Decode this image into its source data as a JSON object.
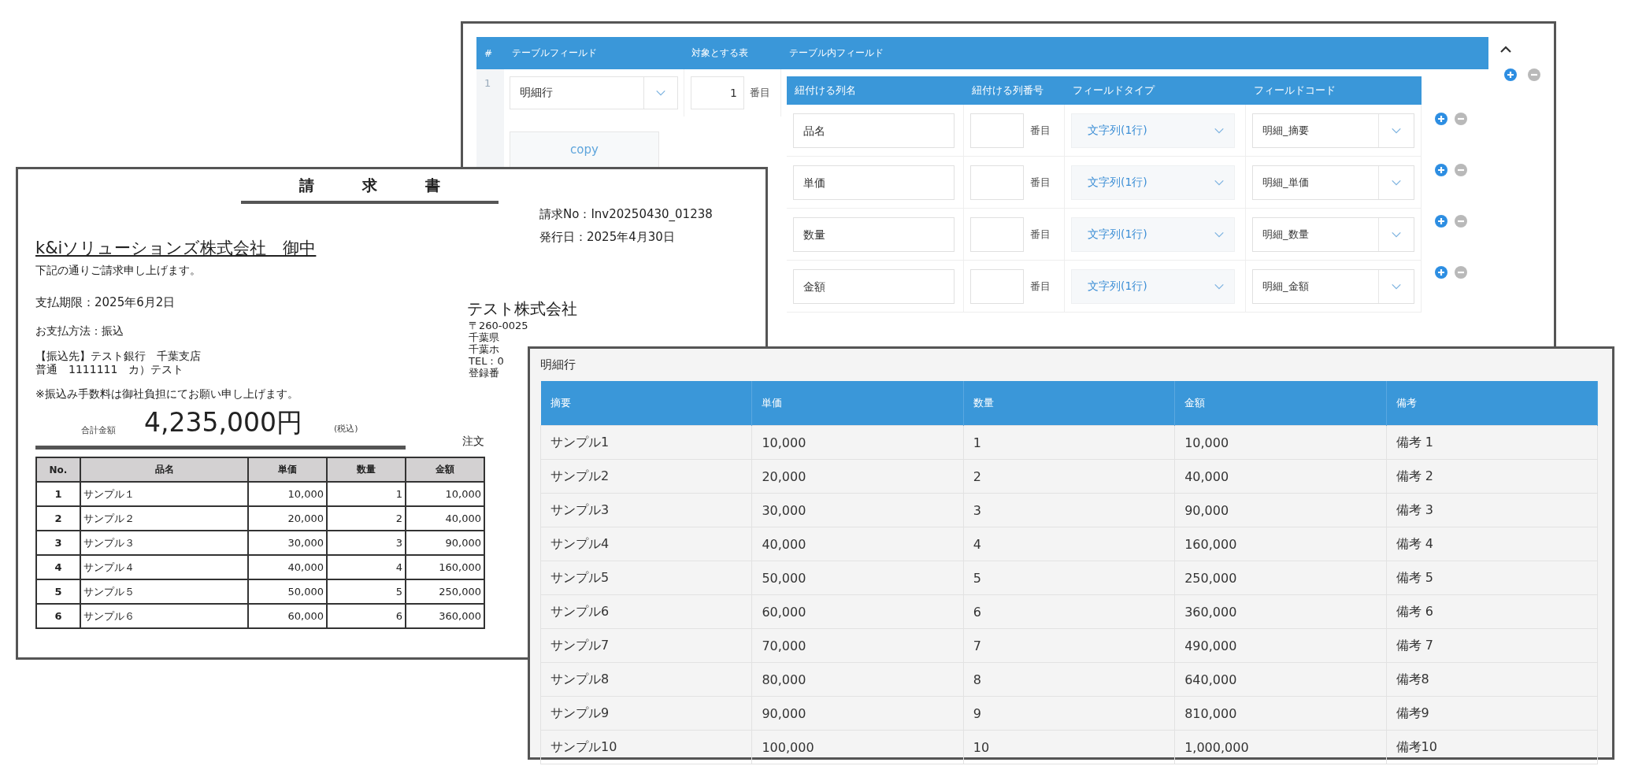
{
  "mapping_window": {
    "header": {
      "index": "#",
      "columns": [
        "テーブルフィールド",
        "対象とする表",
        "テーブル内フィールド"
      ]
    },
    "entry": {
      "index": "1",
      "table_field": "明細行",
      "copy_button": "copy",
      "table_number": "1",
      "number_suffix": "番目",
      "inner_columns": [
        "紐付ける列名",
        "紐付ける列番号",
        "フィールドタイプ",
        "フィールドコード"
      ],
      "rows": [
        {
          "column_name": "品名",
          "suffix": "番目",
          "field_type": "文字列(1行)",
          "field_code": "明細_摘要"
        },
        {
          "column_name": "単価",
          "suffix": "番目",
          "field_type": "文字列(1行)",
          "field_code": "明細_単価"
        },
        {
          "column_name": "数量",
          "suffix": "番目",
          "field_type": "文字列(1行)",
          "field_code": "明細_数量"
        },
        {
          "column_name": "金額",
          "suffix": "番目",
          "field_type": "文字列(1行)",
          "field_code": "明細_金額"
        }
      ]
    }
  },
  "invoice": {
    "title": "請求書",
    "invoice_number": "請求No：Inv20250430_01238",
    "issue_date": "発行日：2025年4月30日",
    "addressee": "k&iソリューションズ株式会社　御中",
    "greeting": "下記の通りご請求申し上げます。",
    "due_date": "支払期限：2025年6月2日",
    "payment_method": "お支払方法：振込",
    "bank": [
      "【振込先】テスト銀行　千葉支店",
      "普通　1111111　カ）テスト"
    ],
    "fee_note": "※振込み手数料は御社負担にてお願い申し上げます。",
    "total_label": "合計金額",
    "total_amount": "4,235,000円",
    "tax_note": "(税込)",
    "order_label": "注文",
    "sender": {
      "name": "テスト株式会社",
      "lines": [
        "〒260-0025",
        "千葉県",
        "千葉ホ",
        "TEL：0",
        "登録番"
      ]
    },
    "table": {
      "columns": [
        "No.",
        "品名",
        "単価",
        "数量",
        "金額"
      ],
      "rows": [
        [
          "1",
          "サンプル１",
          "10,000",
          "1",
          "10,000"
        ],
        [
          "2",
          "サンプル２",
          "20,000",
          "2",
          "40,000"
        ],
        [
          "3",
          "サンプル３",
          "30,000",
          "3",
          "90,000"
        ],
        [
          "4",
          "サンプル４",
          "40,000",
          "4",
          "160,000"
        ],
        [
          "5",
          "サンプル５",
          "50,000",
          "5",
          "250,000"
        ],
        [
          "6",
          "サンプル６",
          "60,000",
          "6",
          "360,000"
        ]
      ]
    }
  },
  "detail_window": {
    "title": "明細行",
    "columns": [
      "摘要",
      "単価",
      "数量",
      "金額",
      "備考"
    ],
    "rows": [
      [
        "サンプル1",
        "10,000",
        "1",
        "10,000",
        "備考 1"
      ],
      [
        "サンプル2",
        "20,000",
        "2",
        "40,000",
        "備考 2"
      ],
      [
        "サンプル3",
        "30,000",
        "3",
        "90,000",
        "備考 3"
      ],
      [
        "サンプル4",
        "40,000",
        "4",
        "160,000",
        "備考 4"
      ],
      [
        "サンプル5",
        "50,000",
        "5",
        "250,000",
        "備考 5"
      ],
      [
        "サンプル6",
        "60,000",
        "6",
        "360,000",
        "備考 6"
      ],
      [
        "サンプル7",
        "70,000",
        "7",
        "490,000",
        "備考 7"
      ],
      [
        "サンプル8",
        "80,000",
        "8",
        "640,000",
        "備考8"
      ],
      [
        "サンプル9",
        "90,000",
        "9",
        "810,000",
        "備考9"
      ],
      [
        "サンプル10",
        "100,000",
        "10",
        "1,000,000",
        "備考10"
      ]
    ]
  }
}
